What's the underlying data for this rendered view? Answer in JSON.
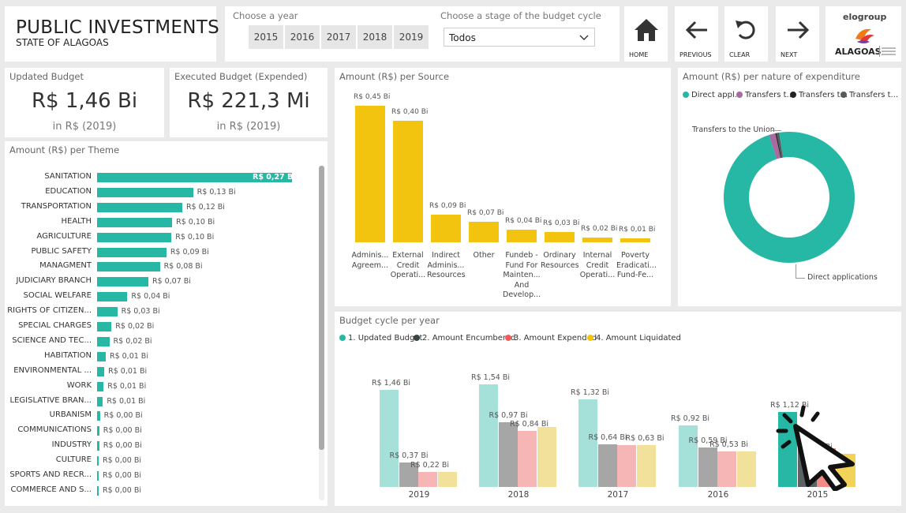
{
  "header": {
    "title": "PUBLIC INVESTMENTS",
    "subtitle": "STATE OF ALAGOAS",
    "year_label": "Choose a year",
    "years": [
      "2015",
      "2016",
      "2017",
      "2018",
      "2019"
    ],
    "stage_label": "Choose a stage of the budget cycle",
    "stage_value": "Todos",
    "nav": {
      "home": "HOME",
      "previous": "PREVIOUS",
      "clear": "CLEAR",
      "next": "NEXT"
    },
    "logo": {
      "brand": "elogroup",
      "state": "ALAGOAS"
    }
  },
  "kpis": {
    "updated": {
      "title": "Updated Budget",
      "value": "R$ 1,46 Bi",
      "sub": "in R$ (2019)"
    },
    "executed": {
      "title": "Executed Budget (Expended)",
      "value": "R$ 221,3 Mi",
      "sub": "in R$ (2019)"
    }
  },
  "charts": {
    "theme_title": "Amount (R$) per Theme",
    "source_title": "Amount (R$) per Source",
    "nature_title": "Amount (R$) per nature of expenditure",
    "cycle_title": "Budget cycle per year"
  },
  "colors": {
    "teal": "#26b8a5",
    "yellow": "#f2c40f",
    "purple": "#a86aa0",
    "dark": "#3a4448",
    "red": "#f25b5b"
  },
  "chart_data": [
    {
      "type": "bar",
      "orientation": "horizontal",
      "title": "Amount (R$) per Theme",
      "categories": [
        "SANITATION",
        "EDUCATION",
        "TRANSPORTATION",
        "HEALTH",
        "AGRICULTURE",
        "PUBLIC SAFETY",
        "MANAGMENT",
        "JUDICIARY BRANCH",
        "SOCIAL WELFARE",
        "RIGHTS OF CITIZEN...",
        "SPECIAL CHARGES",
        "SCIENCE AND TEC...",
        "HABITATION",
        "ENVIRONMENTAL ...",
        "WORK",
        "LEGISLATIVE BRAN...",
        "URBANISM",
        "COMMUNICATIONS",
        "INDUSTRY",
        "CULTURE",
        "SPORTS AND RECR...",
        "COMMERCE AND S..."
      ],
      "values": [
        0.27,
        0.13,
        0.12,
        0.1,
        0.1,
        0.09,
        0.08,
        0.07,
        0.04,
        0.03,
        0.02,
        0.02,
        0.01,
        0.01,
        0.01,
        0.01,
        0.0,
        0.0,
        0.0,
        0.0,
        0.0,
        0.0
      ],
      "bar_values": [
        0.27,
        0.133,
        0.118,
        0.104,
        0.103,
        0.096,
        0.087,
        0.071,
        0.042,
        0.028,
        0.02,
        0.017,
        0.012,
        0.01,
        0.009,
        0.008,
        0.004,
        0.003,
        0.003,
        0.002,
        0.002,
        0.002
      ],
      "labels": [
        "R$ 0,27 Bi",
        "R$ 0,13 Bi",
        "R$ 0,12 Bi",
        "R$ 0,10 Bi",
        "R$ 0,10 Bi",
        "R$ 0,09 Bi",
        "R$ 0,08 Bi",
        "R$ 0,07 Bi",
        "R$ 0,04 Bi",
        "R$ 0,03 Bi",
        "R$ 0,02 Bi",
        "R$ 0,02 Bi",
        "R$ 0,01 Bi",
        "R$ 0,01 Bi",
        "R$ 0,01 Bi",
        "R$ 0,01 Bi",
        "R$ 0,00 Bi",
        "R$ 0,00 Bi",
        "R$ 0,00 Bi",
        "R$ 0,00 Bi",
        "R$ 0,00 Bi",
        "R$ 0,00 Bi"
      ]
    },
    {
      "type": "bar",
      "title": "Amount (R$) per Source",
      "categories": [
        [
          "Adminis...",
          "Agreem..."
        ],
        [
          "External",
          "Credit",
          "Operati..."
        ],
        [
          "Indirect",
          "Adminis...",
          "Resources"
        ],
        [
          "Other"
        ],
        [
          "Fundeb -",
          "Fund For",
          "Mainten...",
          "And",
          "Develop..."
        ],
        [
          "Ordinary",
          "Resources"
        ],
        [
          "Internal",
          "Credit",
          "Operati..."
        ],
        [
          "Poverty",
          "Eradicati...",
          "Fund-Fe..."
        ]
      ],
      "values": [
        0.45,
        0.4,
        0.09,
        0.07,
        0.04,
        0.03,
        0.02,
        0.01
      ],
      "bar_values": [
        0.45,
        0.4,
        0.092,
        0.068,
        0.042,
        0.034,
        0.016,
        0.013
      ],
      "labels": [
        "R$ 0,45 Bi",
        "R$ 0,40 Bi",
        "R$ 0,09 Bi",
        "R$ 0,07 Bi",
        "R$ 0,04 Bi",
        "R$ 0,03 Bi",
        "R$ 0,02 Bi",
        "R$ 0,01 Bi"
      ]
    },
    {
      "type": "pie",
      "donut": true,
      "title": "Amount (R$) per nature of expenditure",
      "legend": [
        "Direct appl...",
        "Transfers t...",
        "Transfers t...",
        "Transfers t..."
      ],
      "legend_position": "top",
      "slices": [
        {
          "name": "Direct applications",
          "value": 0.975,
          "color": "#26b8a5"
        },
        {
          "name": "Transfers t...",
          "value": 0.016,
          "color": "#a86aa0"
        },
        {
          "name": "Transfers t...",
          "value": 0.003,
          "color": "#222222"
        },
        {
          "name": "Transfers to the Union",
          "value": 0.006,
          "color": "#555a5c"
        }
      ],
      "annotations": [
        "Transfers to the Union",
        "Direct applications"
      ]
    },
    {
      "type": "bar",
      "title": "Budget cycle per year",
      "categories": [
        "2019",
        "2018",
        "2017",
        "2016",
        "2015"
      ],
      "series": [
        {
          "name": "1. Updated Budget",
          "color": "#26b8a5",
          "values": [
            1.46,
            1.54,
            1.32,
            0.92,
            1.12
          ],
          "labels": [
            "R$ 1,46 Bi",
            "R$ 1,54 Bi",
            "R$ 1,32 Bi",
            "R$ 0,92 Bi",
            "R$ 1,12 Bi"
          ]
        },
        {
          "name": "2. Amount Encumbered",
          "color": "#3a4448",
          "values": [
            0.37,
            0.97,
            0.64,
            0.59,
            0.6
          ],
          "labels": [
            "R$ 0,37 Bi",
            "R$ 0,97 Bi",
            "R$ 0,64 Bi",
            "R$ 0,59 Bi",
            ""
          ]
        },
        {
          "name": "3. Amount Expended",
          "color": "#f25b5b",
          "values": [
            0.22,
            0.84,
            0.63,
            0.53,
            0.58
          ],
          "labels": [
            "R$ 0,22 Bi",
            "R$ 0,84 Bi",
            "",
            "R$ 0,53 Bi",
            ""
          ]
        },
        {
          "name": "4. Amount Liquidated",
          "color": "#f2c40f",
          "values": [
            0.22,
            0.9,
            0.63,
            0.53,
            0.5
          ],
          "labels": [
            "",
            "",
            "R$ 0,63 Bi",
            "",
            "Bi"
          ]
        }
      ],
      "highlighted": "2015"
    }
  ]
}
